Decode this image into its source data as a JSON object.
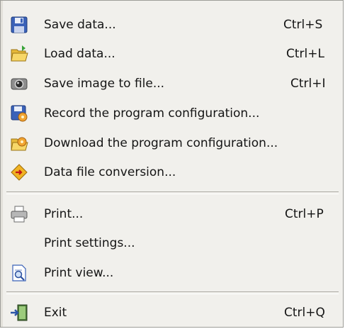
{
  "menu": {
    "items": [
      {
        "label": "Save data...",
        "shortcut": "Ctrl+S",
        "icon": "floppy-disk-icon"
      },
      {
        "label": "Load data...",
        "shortcut": "Ctrl+L",
        "icon": "open-folder-icon"
      },
      {
        "label": "Save image to file...",
        "shortcut": "Ctrl+I",
        "icon": "camera-icon"
      },
      {
        "label": "Record the program configuration...",
        "shortcut": "",
        "icon": "save-config-icon"
      },
      {
        "label": "Download the program configuration...",
        "shortcut": "",
        "icon": "load-config-icon"
      },
      {
        "label": "Data file conversion...",
        "shortcut": "",
        "icon": "conversion-icon"
      },
      {
        "label": "Print...",
        "shortcut": "Ctrl+P",
        "icon": "printer-icon"
      },
      {
        "label": "Print settings...",
        "shortcut": "",
        "icon": ""
      },
      {
        "label": "Print view...",
        "shortcut": "",
        "icon": "print-preview-icon"
      },
      {
        "label": "Exit",
        "shortcut": "Ctrl+Q",
        "icon": "exit-door-icon"
      }
    ]
  },
  "colors": {
    "menu_background": "#f1f0ec",
    "separator": "#aeaca6",
    "text": "#151515"
  }
}
